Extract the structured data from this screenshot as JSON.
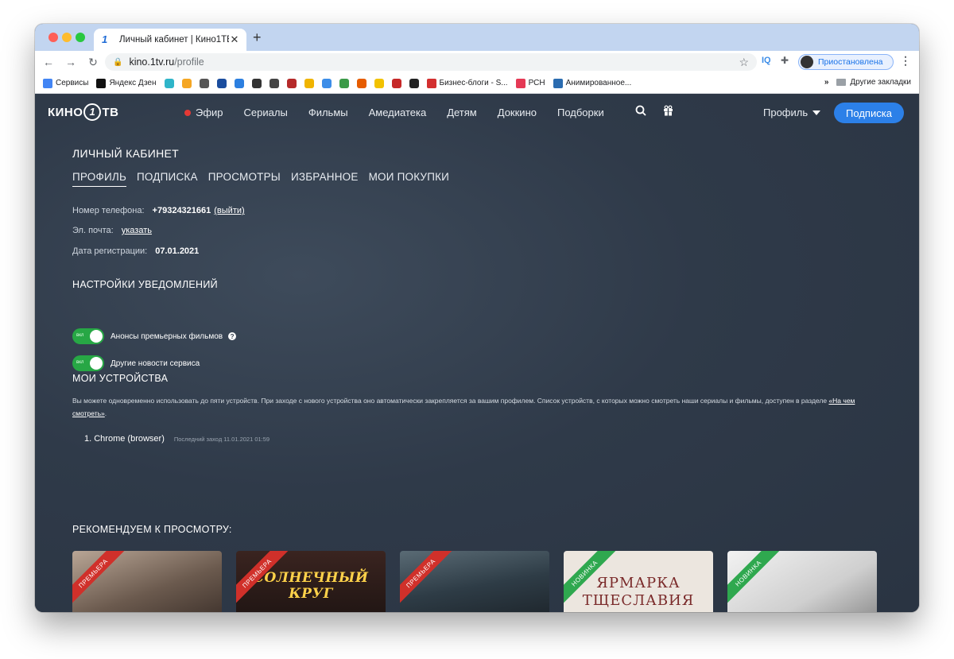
{
  "browser": {
    "tab_title": "Личный кабинет | Кино1ТВ",
    "tab_favicon": "1",
    "url_host": "kino.1tv.ru",
    "url_path": "/profile",
    "ext_iq": "IQ",
    "profile_status": "Приостановлена",
    "bookmarks": [
      {
        "label": "Сервисы",
        "color": "#4285f4"
      },
      {
        "label": "Яндекс Дзен",
        "color": "#111111"
      },
      {
        "label": "",
        "color": "#2fb5c9"
      },
      {
        "label": "",
        "color": "#f5a623"
      },
      {
        "label": "",
        "color": "#555555"
      },
      {
        "label": "",
        "color": "#1b4d9e"
      },
      {
        "label": "",
        "color": "#2c7fe0"
      },
      {
        "label": "",
        "color": "#333333"
      },
      {
        "label": "",
        "color": "#444444"
      },
      {
        "label": "",
        "color": "#b52a2a"
      },
      {
        "label": "",
        "color": "#f0b400"
      },
      {
        "label": "",
        "color": "#3c8de8"
      },
      {
        "label": "",
        "color": "#3b9a48"
      },
      {
        "label": "",
        "color": "#e65c00"
      },
      {
        "label": "",
        "color": "#f2c200"
      },
      {
        "label": "",
        "color": "#c62828"
      },
      {
        "label": "",
        "color": "#222222"
      },
      {
        "label": "Бизнес-блоги - S...",
        "color": "#d32f2f"
      },
      {
        "label": "РСН",
        "color": "#e53955"
      },
      {
        "label": "Анимированное...",
        "color": "#2b6cb0"
      }
    ],
    "bookmarks_more": "»",
    "other_bookmarks": "Другие закладки"
  },
  "site": {
    "logo_left": "КИНО",
    "logo_right": "ТВ",
    "nav": [
      "Эфир",
      "Сериалы",
      "Фильмы",
      "Амедиатека",
      "Детям",
      "Доккино",
      "Подборки"
    ],
    "profile_menu": "Профиль",
    "subscribe": "Подписка"
  },
  "cabinet": {
    "title": "ЛИЧНЫЙ КАБИНЕТ",
    "tabs": [
      "ПРОФИЛЬ",
      "ПОДПИСКА",
      "ПРОСМОТРЫ",
      "ИЗБРАННОЕ",
      "МОИ ПОКУПКИ"
    ],
    "phone_label": "Номер телефона:",
    "phone_value": "+79324321661",
    "logout": "(выйти)",
    "email_label": "Эл. почта:",
    "email_link": "указать",
    "reg_label": "Дата регистрации:",
    "reg_value": "07.01.2021"
  },
  "notifications": {
    "title": "НАСТРОЙКИ УВЕДОМЛЕНИЙ",
    "toggle_text": "вкл",
    "items": [
      {
        "label": "Анонсы премьерных фильмов",
        "enabled": true
      },
      {
        "label": "Другие новости сервиса",
        "enabled": true
      }
    ]
  },
  "devices": {
    "title": "МОИ УСТРОЙСТВА",
    "desc": "Вы можете одновременно использовать до пяти устройств. При заходе с нового устройства оно автоматически закрепляется за вашим профилем. Список устройств, с которых можно смотреть наши сериалы и фильмы, доступен в разделе ",
    "desc_link": "«На чем смотреть»",
    "desc_end": ".",
    "list": [
      {
        "name": "1. Chrome (browser)",
        "meta": "Последний заход 11.01.2021 01:59"
      }
    ]
  },
  "recommend": {
    "title": "РЕКОМЕНДУЕМ К ПРОСМОТРУ:",
    "cards": [
      {
        "badge": "ПРЕМЬЕРА",
        "badge_color": "red",
        "title": "",
        "bg": "#6b5a4e"
      },
      {
        "badge": "ПРЕМЬЕРА",
        "badge_color": "red",
        "title": "СОЛНЕЧНЫЙ КРУГ",
        "bg": "#2a1e1a"
      },
      {
        "badge": "ПРЕМЬЕРА",
        "badge_color": "red",
        "title": "",
        "bg": "#3a4a55"
      },
      {
        "badge": "НОВИНКА",
        "badge_color": "green",
        "title": "ЯРМАРКА ТЩЕСЛАВИЯ",
        "bg": "#e9e3dc"
      },
      {
        "badge": "НОВИНКА",
        "badge_color": "green",
        "title": "",
        "bg": "#d9d9d9"
      }
    ]
  },
  "colors": {
    "accent": "#2c80e8",
    "toggle_on": "#27a745",
    "live": "#e53935"
  }
}
